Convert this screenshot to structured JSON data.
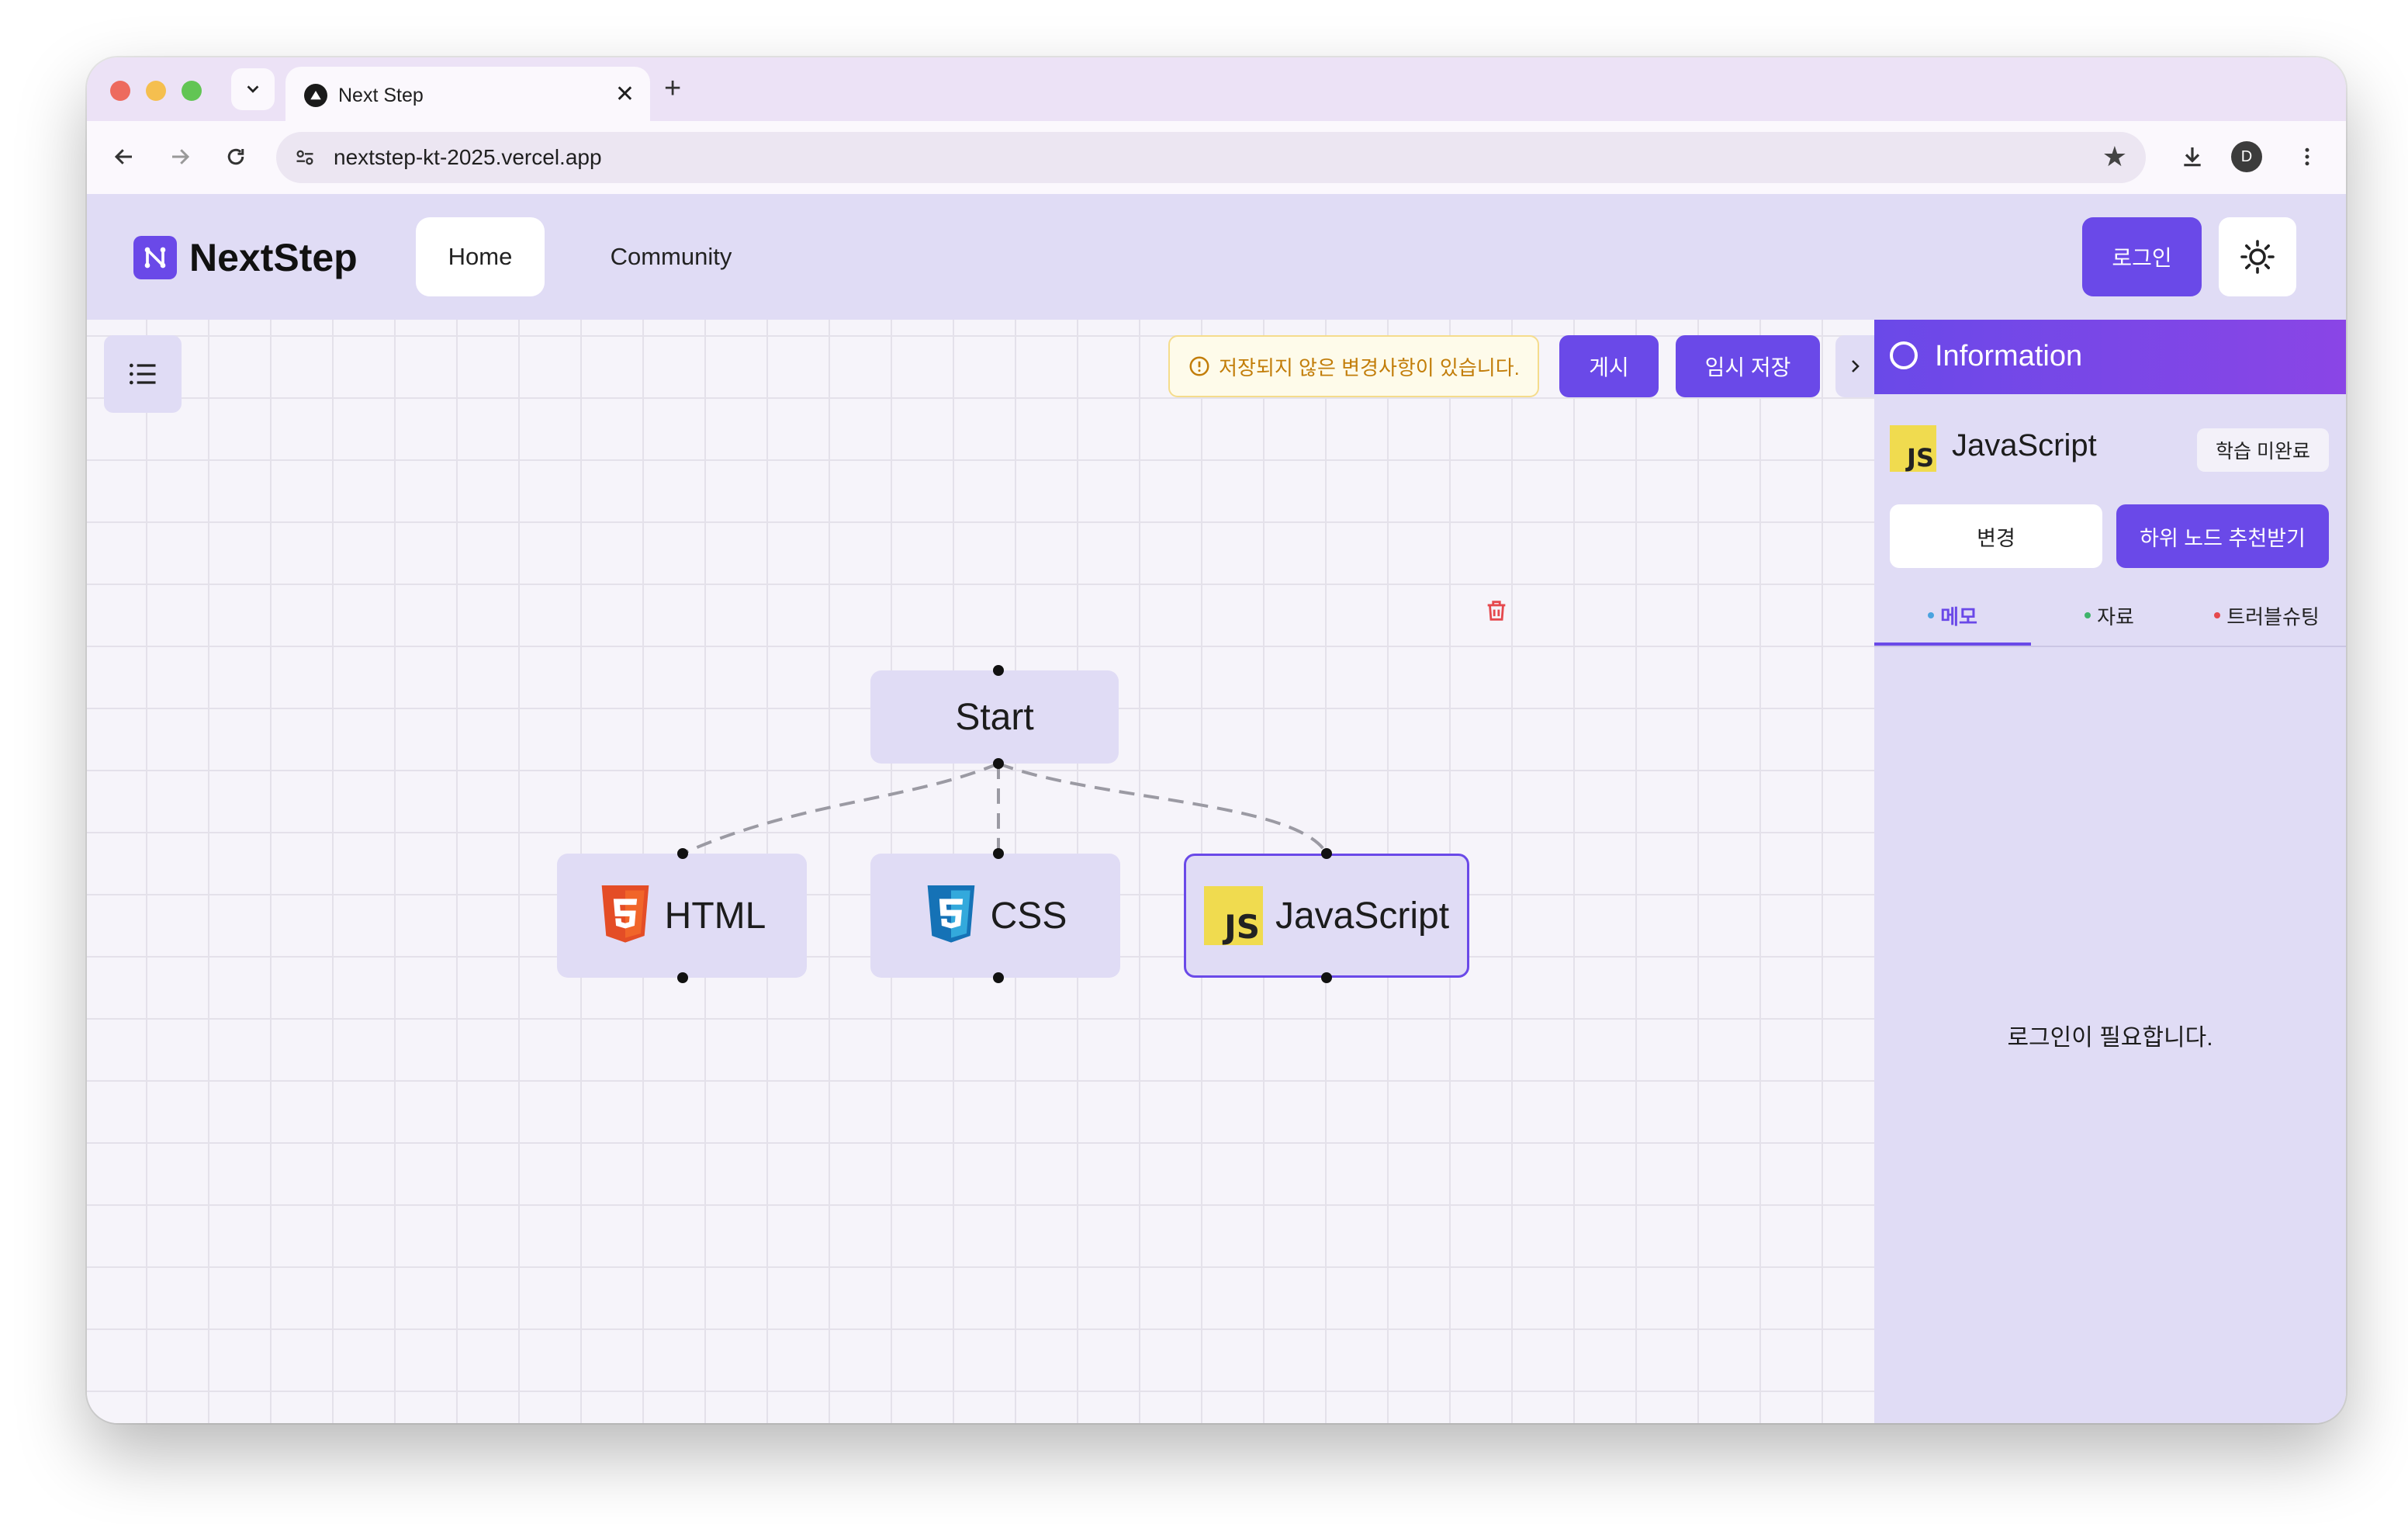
{
  "browser": {
    "tab_title": "Next Step",
    "url": "nextstep-kt-2025.vercel.app",
    "profile_initial": "D",
    "colors": {
      "close": "#ed6a5e",
      "minimize": "#f5bf4f",
      "maximize": "#62c554"
    }
  },
  "header": {
    "logo_text": "NextStep",
    "nav": {
      "home": "Home",
      "community": "Community"
    },
    "login_label": "로그인"
  },
  "toolbar": {
    "unsaved_notice": "저장되지 않은 변경사항이 있습니다.",
    "publish_label": "게시",
    "draft_save_label": "임시 저장"
  },
  "nodes": {
    "start": "Start",
    "html": "HTML",
    "css": "CSS",
    "javascript": "JavaScript",
    "js_badge": "JS"
  },
  "sidebar": {
    "title": "Information",
    "node_title": "JavaScript",
    "status": "학습 미완료",
    "change_label": "변경",
    "recommend_label": "하위 노드 추천받기",
    "tabs": [
      {
        "label": "메모",
        "dot": "#4aa3df",
        "active": true
      },
      {
        "label": "자료",
        "dot": "#3fb36b",
        "active": false
      },
      {
        "label": "트러블슈팅",
        "dot": "#e5484d",
        "active": false
      }
    ],
    "message": "로그인이 필요합니다."
  },
  "colors": {
    "accent": "#6a49e8",
    "node_bg": "#e0dcf5",
    "warning": "#c27d09"
  }
}
